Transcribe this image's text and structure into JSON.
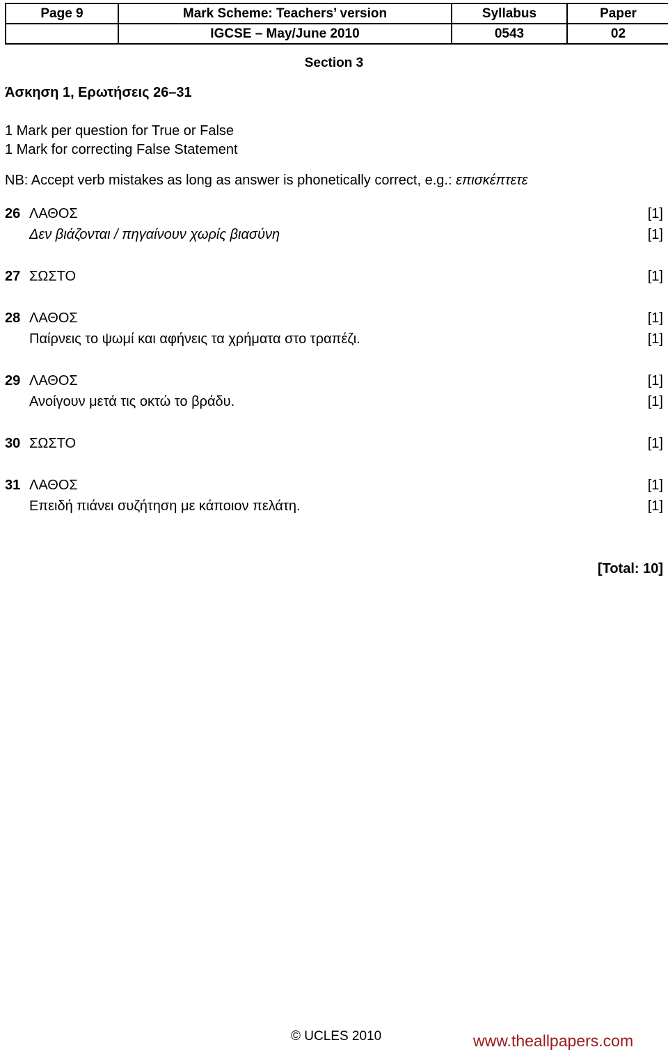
{
  "header": {
    "columns": [
      "Page 9",
      "Mark Scheme: Teachers’ version",
      "Syllabus",
      "Paper"
    ],
    "row2": [
      "",
      "IGCSE – May/June 2010",
      "0543",
      "02"
    ]
  },
  "section": {
    "title": "Section 3"
  },
  "exercise": {
    "title": "Άσκηση 1, Ερωτήσεις 26–31"
  },
  "instructions": {
    "line1": "1 Mark per question for True or False",
    "line2": "1 Mark for correcting False Statement",
    "nb_prefix": "NB: Accept verb mistakes as long as answer is phonetically correct, e.g.: ",
    "nb_italic": "επισκέπτετε"
  },
  "answers": [
    {
      "number": "26",
      "answer": "ΛΑΘΟΣ",
      "answer_mark": "[1]",
      "correction": "Δεν βιάζονται / πηγαίνουν χωρίς βιασύνη",
      "correction_mark": "[1]",
      "correction_italic": true
    },
    {
      "number": "27",
      "answer": "ΣΩΣΤΟ",
      "answer_mark": "[1]",
      "correction": "",
      "correction_mark": "",
      "correction_italic": false
    },
    {
      "number": "28",
      "answer": "ΛΑΘΟΣ",
      "answer_mark": "[1]",
      "correction": "Παίρνεις το ψωμί και αφήνεις τα χρήματα στο τραπέζι.",
      "correction_mark": "[1]",
      "correction_italic": false
    },
    {
      "number": "29",
      "answer": "ΛΑΘΟΣ",
      "answer_mark": "[1]",
      "correction": "Ανοίγουν μετά τις οκτώ το βράδυ.",
      "correction_mark": "[1]",
      "correction_italic": false
    },
    {
      "number": "30",
      "answer": "ΣΩΣΤΟ",
      "answer_mark": "[1]",
      "correction": "",
      "correction_mark": "",
      "correction_italic": false
    },
    {
      "number": "31",
      "answer": "ΛΑΘΟΣ",
      "answer_mark": "[1]",
      "correction": "Επειδή πιάνει συζήτηση με κάποιον πελάτη.",
      "correction_mark": "[1]",
      "correction_italic": false
    }
  ],
  "total": "[Total: 10]",
  "footer": {
    "copyright": "© UCLES 2010",
    "watermark": "www.theallpapers.com",
    "watermark_color": "#9B1B1B"
  }
}
